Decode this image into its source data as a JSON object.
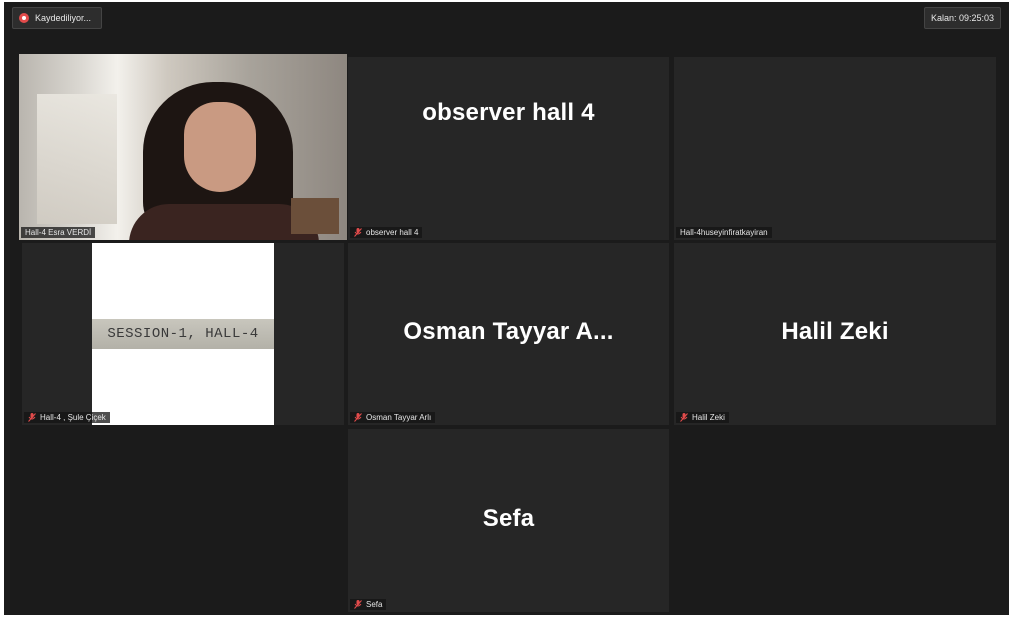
{
  "recording": {
    "label": "Kaydediliyor..."
  },
  "timer": {
    "label": "Kalan: 09:25:03"
  },
  "tiles": [
    {
      "id": "esra",
      "label": "Hall-4 Esra VERDİ",
      "muted": false,
      "active": true
    },
    {
      "id": "observer",
      "display_name": "observer hall 4",
      "label": "observer hall 4",
      "muted": true
    },
    {
      "id": "huseyin",
      "label": "Hall-4huseyinfiratkayiran",
      "muted": false
    },
    {
      "id": "sule",
      "label": "Hall-4 , Şule Çiçek",
      "muted": true,
      "slide_text": "SESSION-1, HALL-4"
    },
    {
      "id": "osman",
      "display_name": "Osman  Tayyar  A...",
      "label": "Osman Tayyar Arlı",
      "muted": true
    },
    {
      "id": "halil",
      "display_name": "Halil Zeki",
      "label": "Halil Zeki",
      "muted": true
    },
    {
      "id": "sefa",
      "display_name": "Sefa",
      "label": "Sefa",
      "muted": true
    }
  ],
  "colors": {
    "background": "#1b1b1b",
    "tile": "#262626",
    "active_border": "#b7d94a",
    "muted_icon": "#e24b4b"
  },
  "icons": {
    "recording": "record-icon",
    "muted": "mic-muted-icon"
  }
}
